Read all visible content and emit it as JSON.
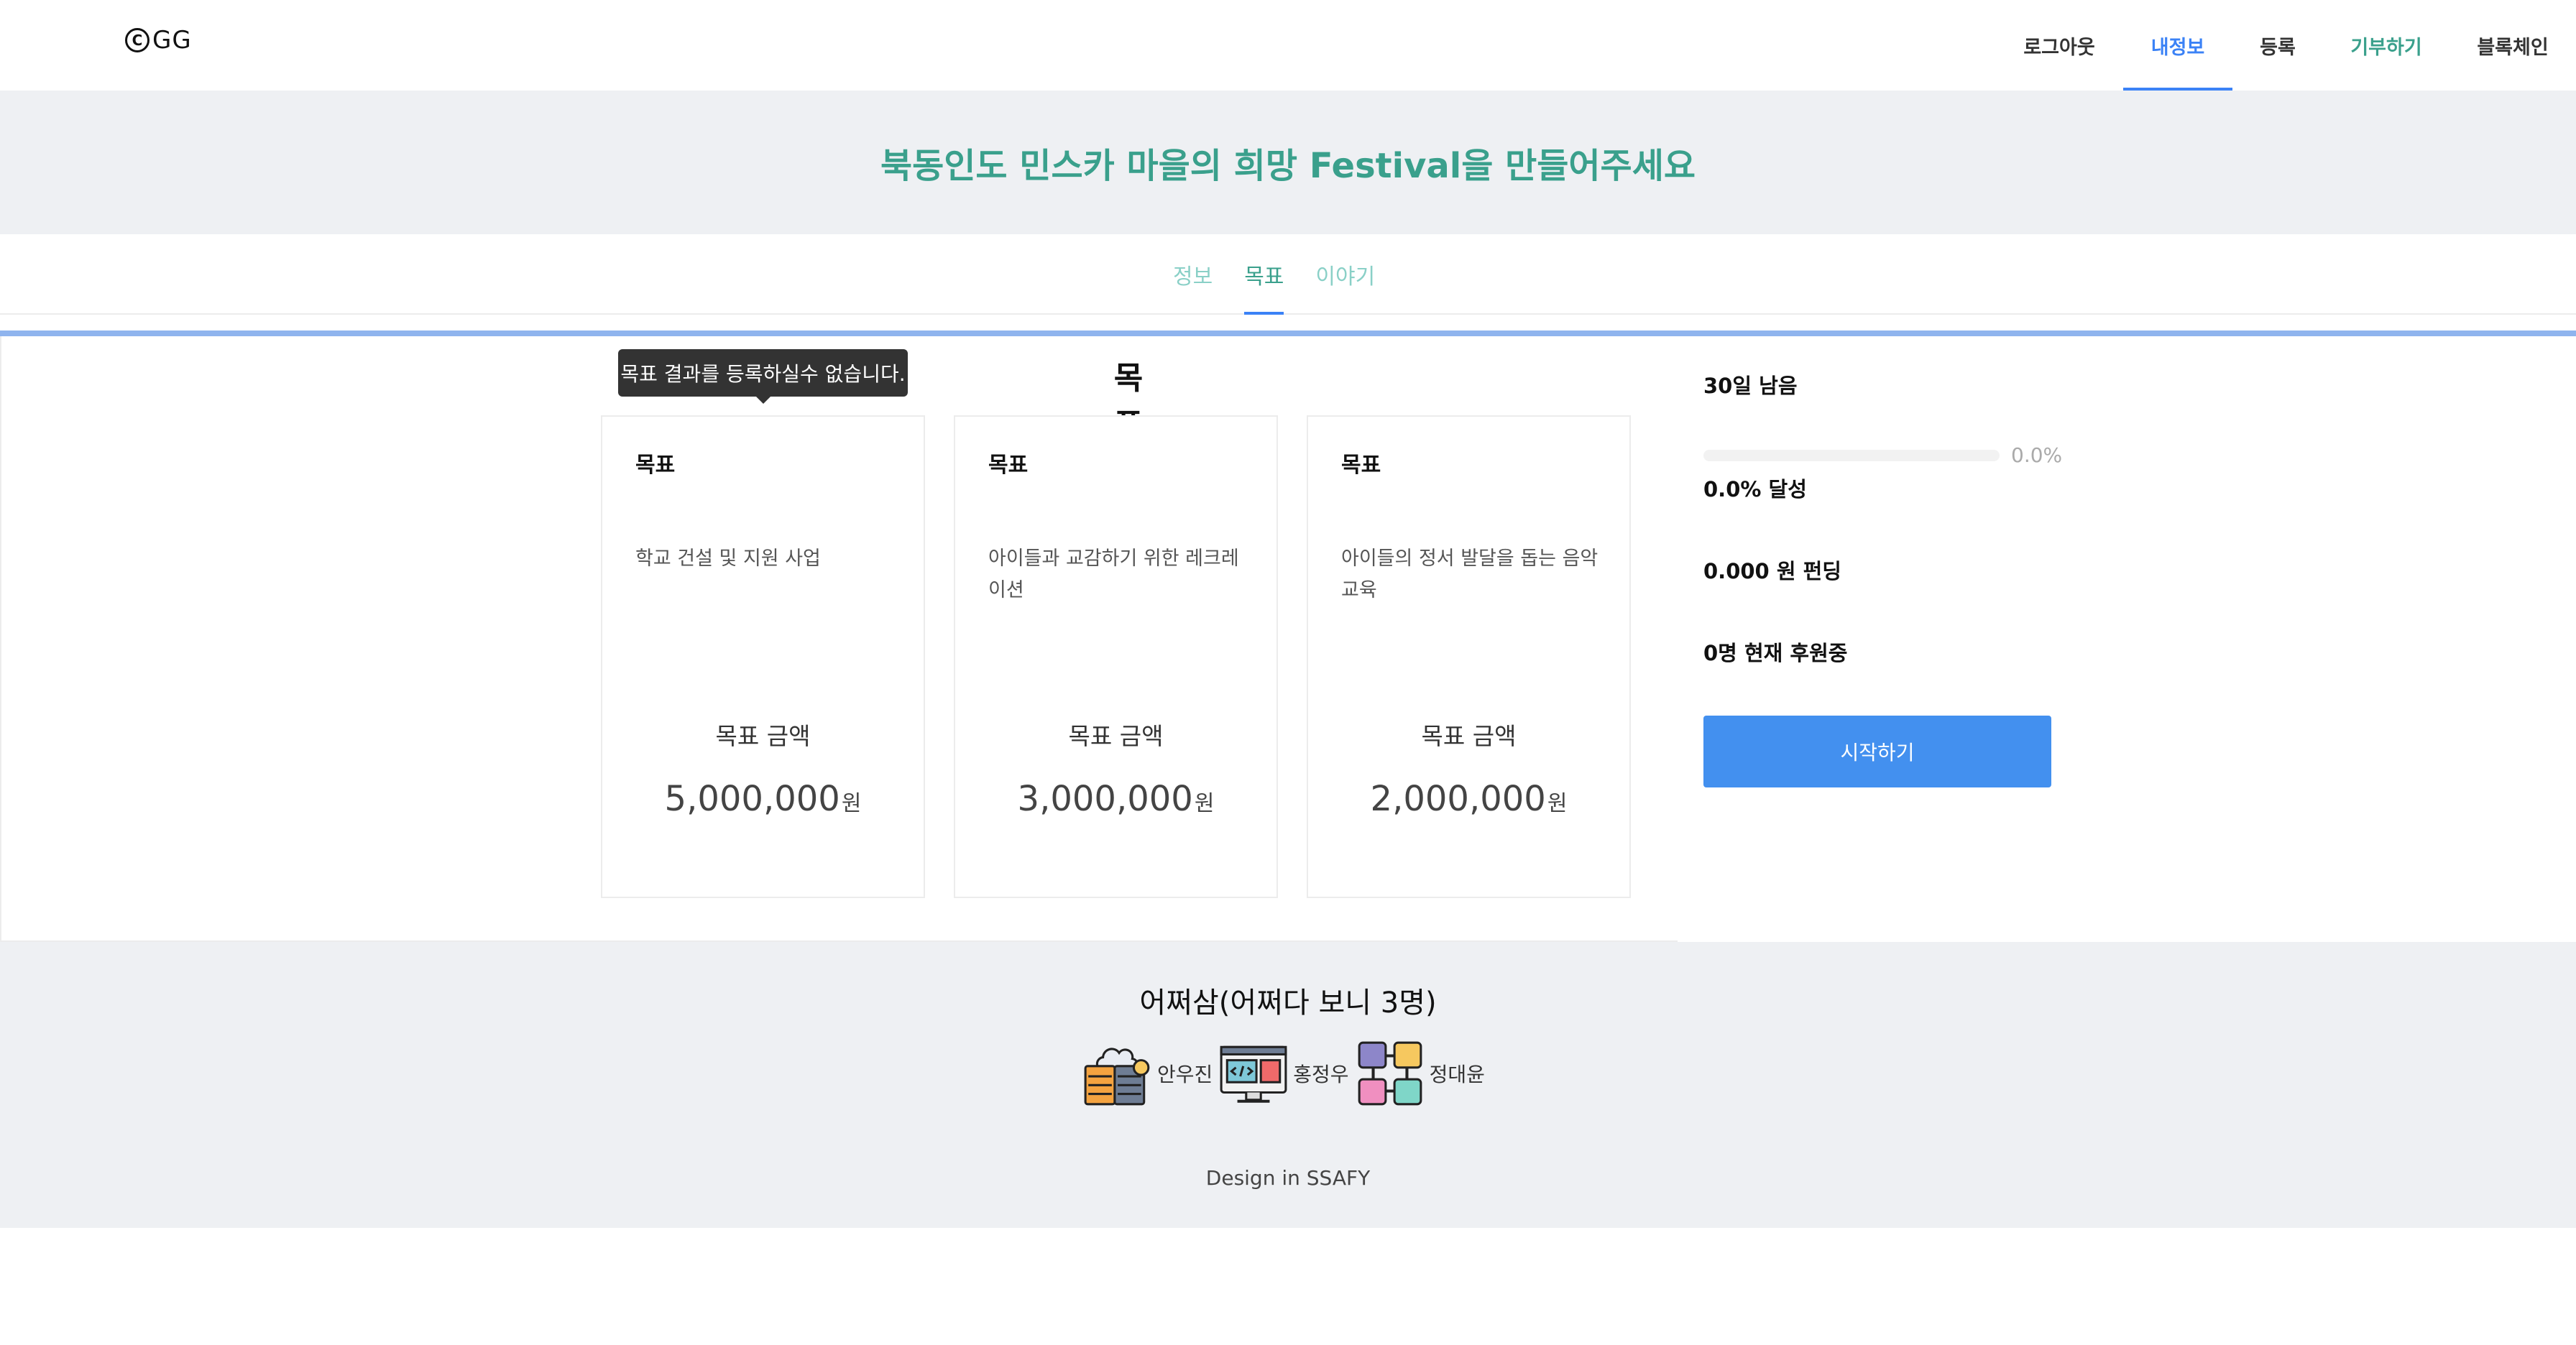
{
  "header": {
    "logo_symbol": "C",
    "logo_text": "GG",
    "nav": [
      {
        "label": "로그아웃"
      },
      {
        "label": "내정보"
      },
      {
        "label": "등록"
      },
      {
        "label": "기부하기"
      },
      {
        "label": "블록체인"
      }
    ]
  },
  "banner": {
    "title": "북동인도 민스카 마을의 희망 Festival을 만들어주세요"
  },
  "tabs": [
    {
      "label": "정보"
    },
    {
      "label": "목표"
    },
    {
      "label": "이야기"
    }
  ],
  "main": {
    "heading": "목표",
    "tooltip": "목표 결과를 등록하실수 없습니다.",
    "cards": [
      {
        "label": "목표",
        "desc": "학교 건설 및 지원 사업",
        "amount_label": "목표 금액",
        "amount": "5,000,000",
        "unit": "원"
      },
      {
        "label": "목표",
        "desc": "아이들과 교감하기 위한 레크레이션",
        "amount_label": "목표 금액",
        "amount": "3,000,000",
        "unit": "원"
      },
      {
        "label": "목표",
        "desc": "아이들의 정서 발달을 돕는 음악교육",
        "amount_label": "목표 금액",
        "amount": "2,000,000",
        "unit": "원"
      }
    ]
  },
  "side": {
    "days_left": "30일 남음",
    "progress_percent": 0.0,
    "progress_text": "0.0%",
    "achieve_text": "0.0% 달성",
    "funding_text": "0.000 원 펀딩",
    "sponsors_text": "0명 현재 후원중",
    "start_button": "시작하기"
  },
  "footer": {
    "team_title": "어쩌삼(어쩌다 보니 3명)",
    "members": [
      {
        "name": "안우진",
        "icon": "server-icon"
      },
      {
        "name": "홍정우",
        "icon": "code-monitor-icon"
      },
      {
        "name": "정대윤",
        "icon": "blockchain-icon"
      }
    ],
    "credit": "Design in SSAFY"
  }
}
